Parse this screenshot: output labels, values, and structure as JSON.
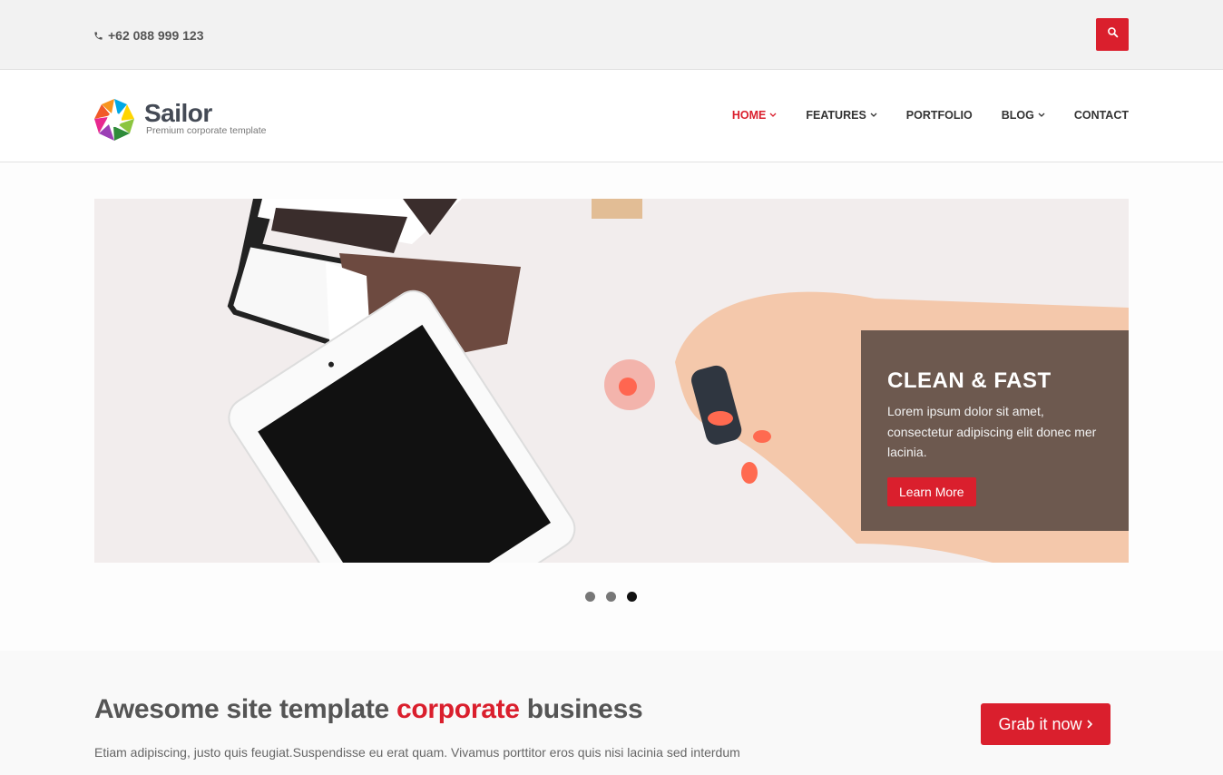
{
  "topbar": {
    "phone": "+62 088 999 123",
    "phone_icon": "phone-icon",
    "search_icon": "search-icon",
    "accent": "#da1f2d"
  },
  "header": {
    "logo_name": "Sailor",
    "logo_tagline": "Premium corporate template",
    "nav": [
      {
        "label": "HOME",
        "active": true,
        "dropdown": true
      },
      {
        "label": "FEATURES",
        "active": false,
        "dropdown": true
      },
      {
        "label": "PORTFOLIO",
        "active": false,
        "dropdown": false
      },
      {
        "label": "BLOG",
        "active": false,
        "dropdown": true
      },
      {
        "label": "CONTACT",
        "active": false,
        "dropdown": false
      }
    ]
  },
  "slider": {
    "caption_title": "CLEAN & FAST",
    "caption_text": "Lorem ipsum dolor sit amet, consectetur adipiscing elit donec mer lacinia.",
    "caption_button": "Learn More",
    "dots": 3,
    "active_dot": 3
  },
  "promo": {
    "title_before": "Awesome site template ",
    "title_highlight": "corporate",
    "title_after": " business",
    "text": "Etiam adipiscing, justo quis feugiat.Suspendisse eu erat quam. Vivamus porttitor eros quis nisi lacinia sed interdum",
    "button_label": "Grab it now",
    "button_icon": "chevron-right-icon"
  }
}
